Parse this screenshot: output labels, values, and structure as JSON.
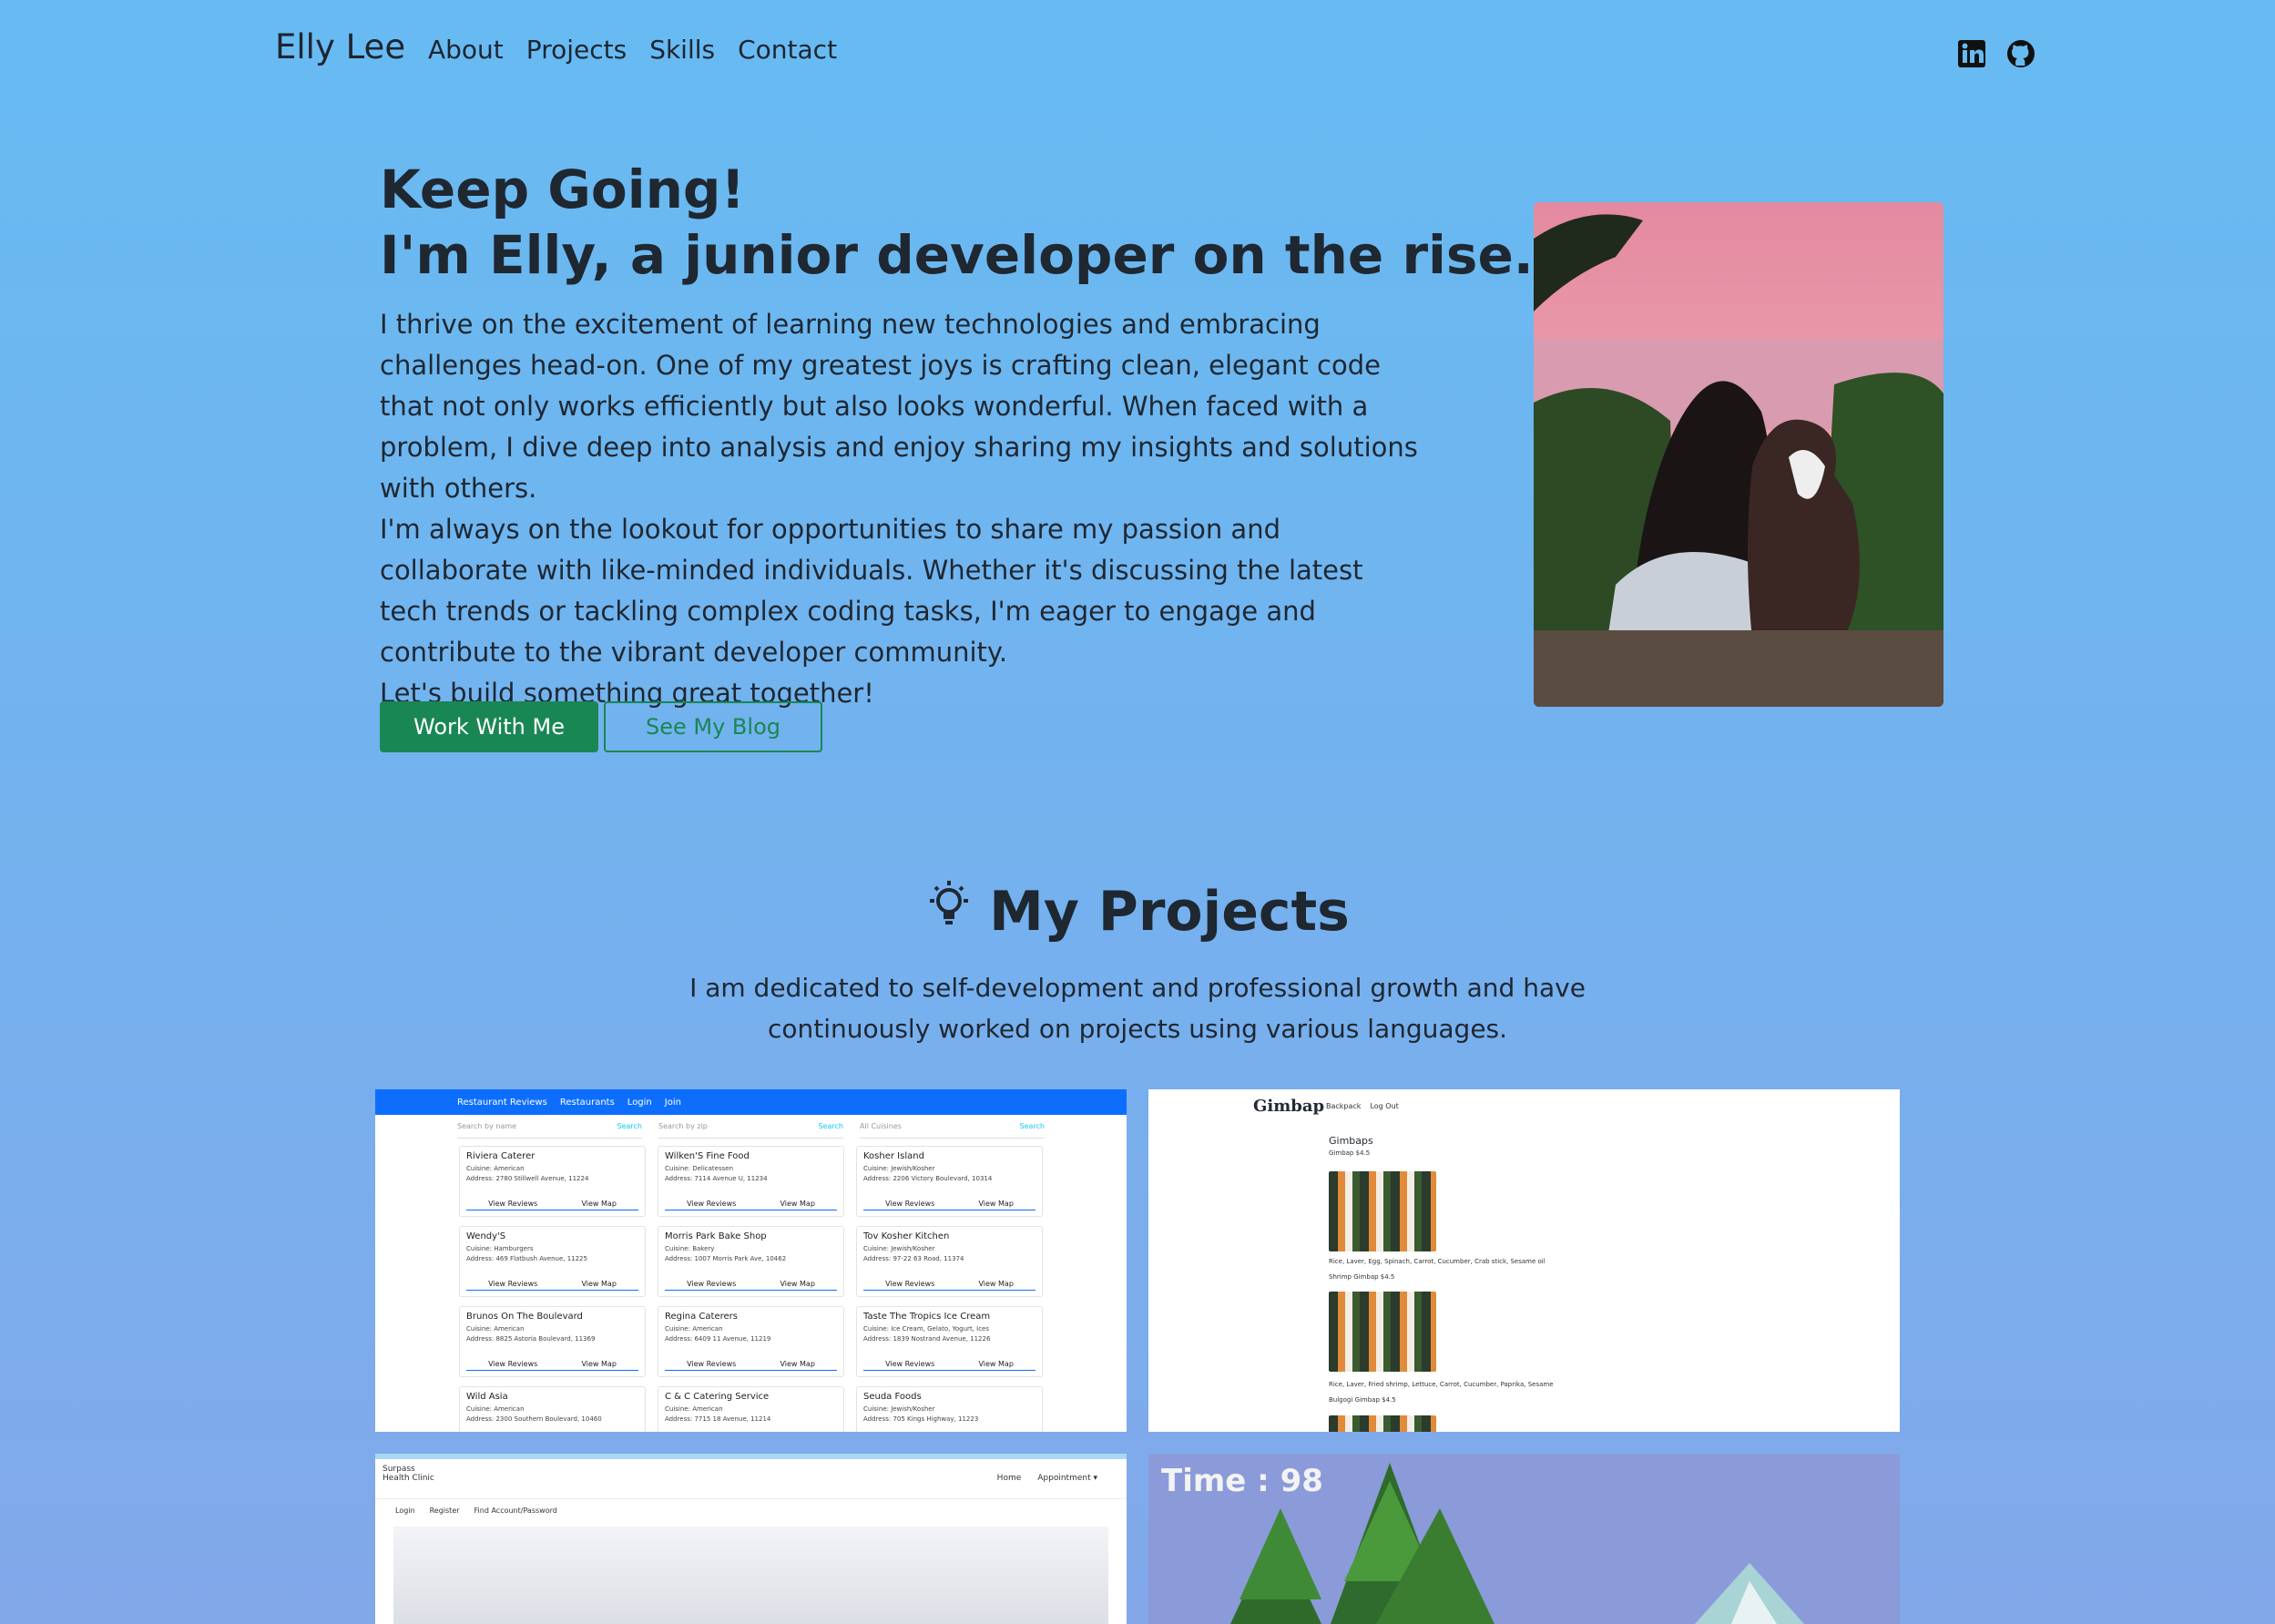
{
  "nav": {
    "brand": "Elly Lee",
    "links": [
      "About",
      "Projects",
      "Skills",
      "Contact"
    ],
    "social": [
      "linkedin-icon",
      "github-icon"
    ]
  },
  "hero": {
    "title_line1": "Keep Going!",
    "title_line2": "I'm Elly, a junior developer on the rise.",
    "paragraph1": "I thrive on the excitement of learning new technologies and embracing challenges head-on. One of my greatest joys is crafting clean, elegant code that not only works efficiently but also looks wonderful. When faced with a problem, I dive deep into analysis and enjoy sharing my insights and solutions with others.",
    "paragraph2": "I'm always on the lookout for opportunities to share my passion and collaborate with like-minded individuals. Whether it's discussing the latest tech trends or tackling complex coding tasks, I'm eager to engage and contribute to the vibrant developer community.",
    "paragraph3": "Let's build something great together!",
    "primary_button": "Work With Me",
    "secondary_button": "See My Blog"
  },
  "projects": {
    "title": "My Projects",
    "subtitle": "I am dedicated to self-development and professional growth and have continuously worked on projects using various languages.",
    "restaurant": {
      "bar": [
        "Restaurant Reviews",
        "Restaurants",
        "Login",
        "Join"
      ],
      "searches": [
        {
          "placeholder": "Search by name",
          "button": "Search"
        },
        {
          "placeholder": "Search by zip",
          "button": "Search"
        },
        {
          "placeholder": "All Cuisines",
          "button": "Search"
        }
      ],
      "cards": [
        {
          "name": "Riviera Caterer",
          "cuisine": "Cuisine: American",
          "address": "Address: 2780 Stillwell Avenue, 11224"
        },
        {
          "name": "Wilken'S Fine Food",
          "cuisine": "Cuisine: Delicatessen",
          "address": "Address: 7114 Avenue U, 11234"
        },
        {
          "name": "Kosher Island",
          "cuisine": "Cuisine: Jewish/Kosher",
          "address": "Address: 2206 Victory Boulevard, 10314"
        },
        {
          "name": "Wendy'S",
          "cuisine": "Cuisine: Hamburgers",
          "address": "Address: 469 Flatbush Avenue, 11225"
        },
        {
          "name": "Morris Park Bake Shop",
          "cuisine": "Cuisine: Bakery",
          "address": "Address: 1007 Morris Park Ave, 10462"
        },
        {
          "name": "Tov Kosher Kitchen",
          "cuisine": "Cuisine: Jewish/Kosher",
          "address": "Address: 97-22 63 Road, 11374"
        },
        {
          "name": "Brunos On The Boulevard",
          "cuisine": "Cuisine: American",
          "address": "Address: 8825 Astoria Boulevard, 11369"
        },
        {
          "name": "Regina Caterers",
          "cuisine": "Cuisine: American",
          "address": "Address: 6409 11 Avenue, 11219"
        },
        {
          "name": "Taste The Tropics Ice Cream",
          "cuisine": "Cuisine: Ice Cream, Gelato, Yogurt, Ices",
          "address": "Address: 1839 Nostrand Avenue, 11226"
        },
        {
          "name": "Wild Asia",
          "cuisine": "Cuisine: American",
          "address": "Address: 2300 Southern Boulevard, 10460"
        },
        {
          "name": "C & C Catering Service",
          "cuisine": "Cuisine: American",
          "address": "Address: 7715 18 Avenue, 11214"
        },
        {
          "name": "Seuda Foods",
          "cuisine": "Cuisine: Jewish/Kosher",
          "address": "Address: 705 Kings Highway, 11223"
        }
      ],
      "actions": [
        "View Reviews",
        "View Map"
      ]
    },
    "gimbap": {
      "brand": "Gimbap",
      "nav": [
        "Backpack",
        "Log Out"
      ],
      "heading": "Gimbaps",
      "items": [
        "Gimbap $4.5",
        "Rice, Laver, Egg, Spinach, Carrot, Cucumber, Crab stick, Sesame oil",
        "Shrimp Gimbap $4.5",
        "Rice, Laver, Fried shrimp, Lettuce, Carrot, Cucumber, Paprika, Sesame",
        "Bulgogi Gimbap $4.5"
      ]
    },
    "clinic": {
      "logo": "Surpass Health Clinic",
      "links": [
        "Home",
        "Appointment ▾"
      ],
      "sub": [
        "Login",
        "Register",
        "Find Account/Password"
      ]
    },
    "game": {
      "time": "Time  : 98"
    }
  }
}
